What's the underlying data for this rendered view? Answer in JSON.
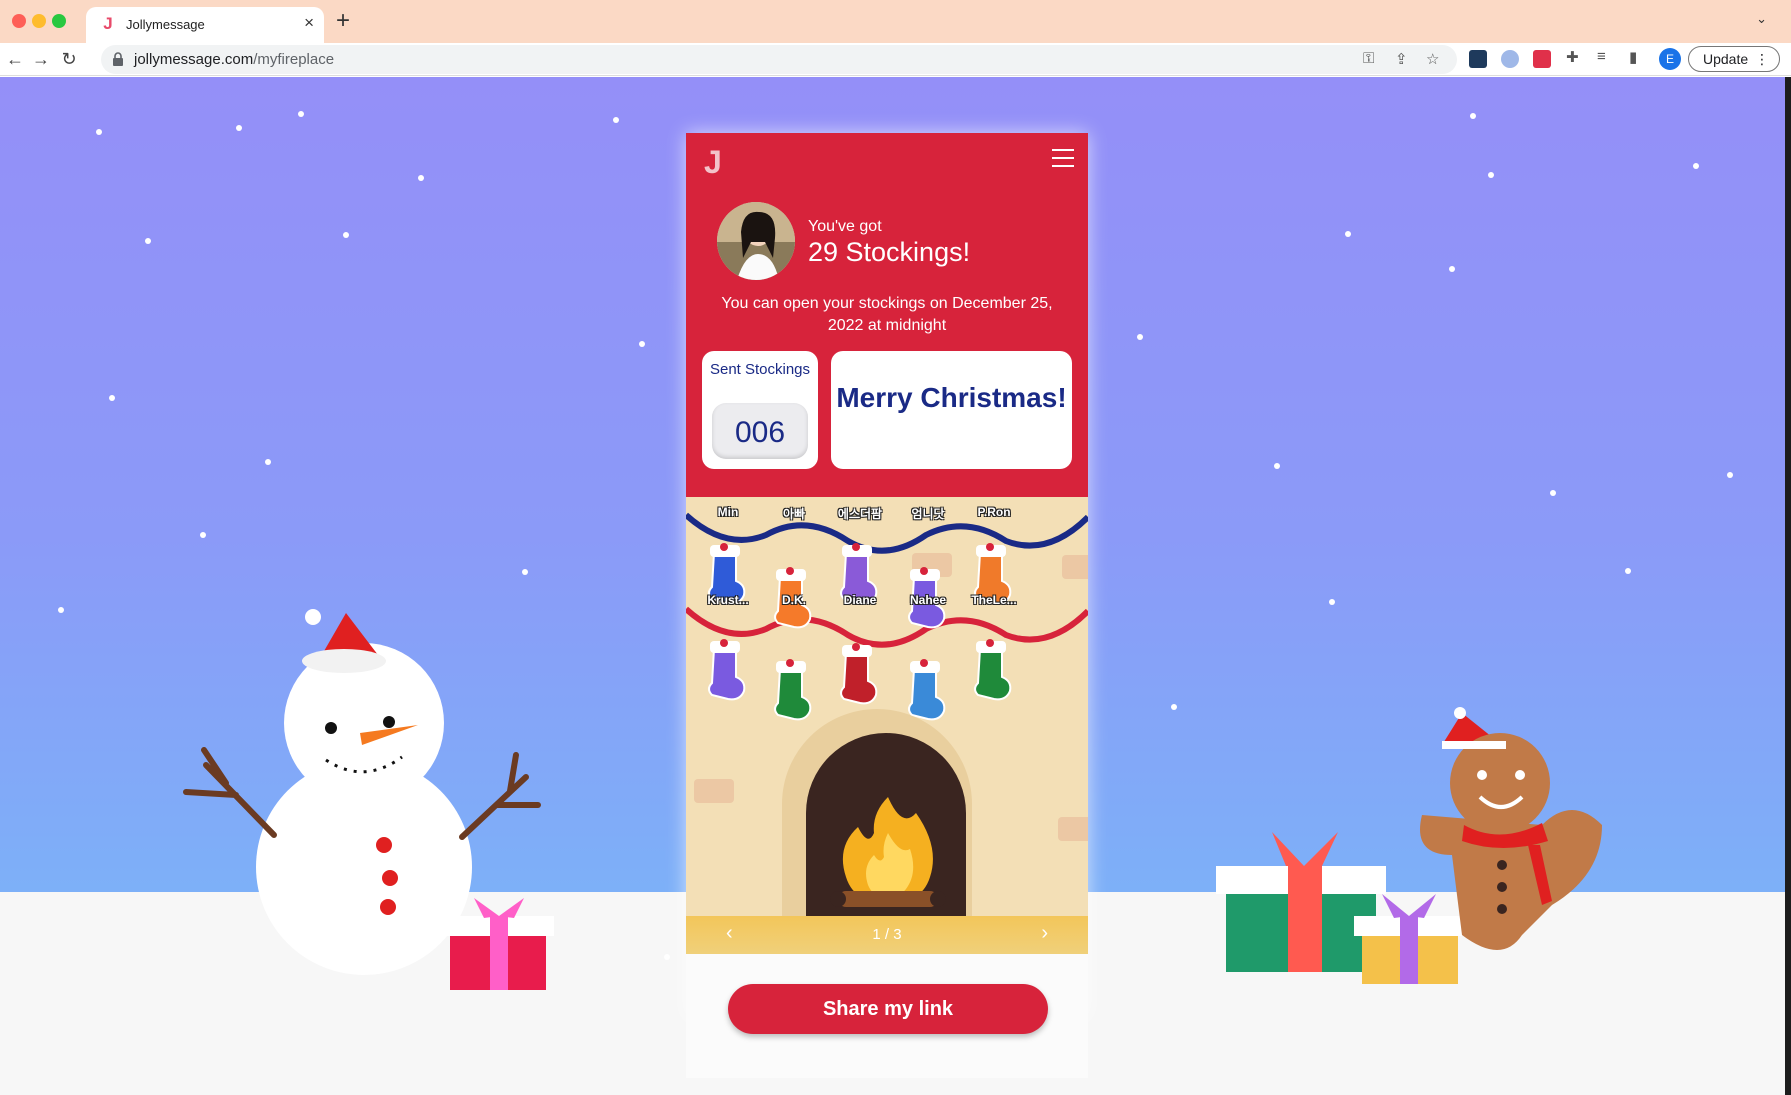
{
  "browser": {
    "tab_title": "Jollymessage",
    "tab_favicon": "J",
    "url_host": "jollymessage.com",
    "url_path": "/myfireplace",
    "profile_initial": "E",
    "update_label": "Update"
  },
  "app": {
    "logo": "J",
    "header": {
      "got_label": "You've got",
      "got_count": "29 Stockings!",
      "open_note": "You can open your stockings on December 25, 2022 at midnight"
    },
    "sent": {
      "label": "Sent Stockings",
      "count": "006"
    },
    "greeting": "Merry Christmas!",
    "stockings_row1": [
      {
        "name": "Min",
        "color": "#2f5bd8"
      },
      {
        "name": "아빠",
        "color": "#f57a2a"
      },
      {
        "name": "에스더팜",
        "color": "#8a5ad8"
      },
      {
        "name": "엄니닷",
        "color": "#7a5ae0"
      },
      {
        "name": "P.Ron",
        "color": "#f07a2a"
      }
    ],
    "stockings_row2": [
      {
        "name": "Krust...",
        "color": "#7a5ae0"
      },
      {
        "name": "D.K.",
        "color": "#1f8a3a"
      },
      {
        "name": "Diane",
        "color": "#c0202a"
      },
      {
        "name": "Nahee",
        "color": "#3a8ad8"
      },
      {
        "name": "TheLe...",
        "color": "#1f8a3a"
      }
    ],
    "pager": {
      "prev": "‹",
      "next": "›",
      "text": "1 / 3"
    },
    "share_button": "Share my link"
  },
  "colors": {
    "brand_red": "#d7233b",
    "navy_text": "#1a2a86",
    "sky_top": "#948ff8",
    "sky_bottom": "#7db0f8"
  }
}
